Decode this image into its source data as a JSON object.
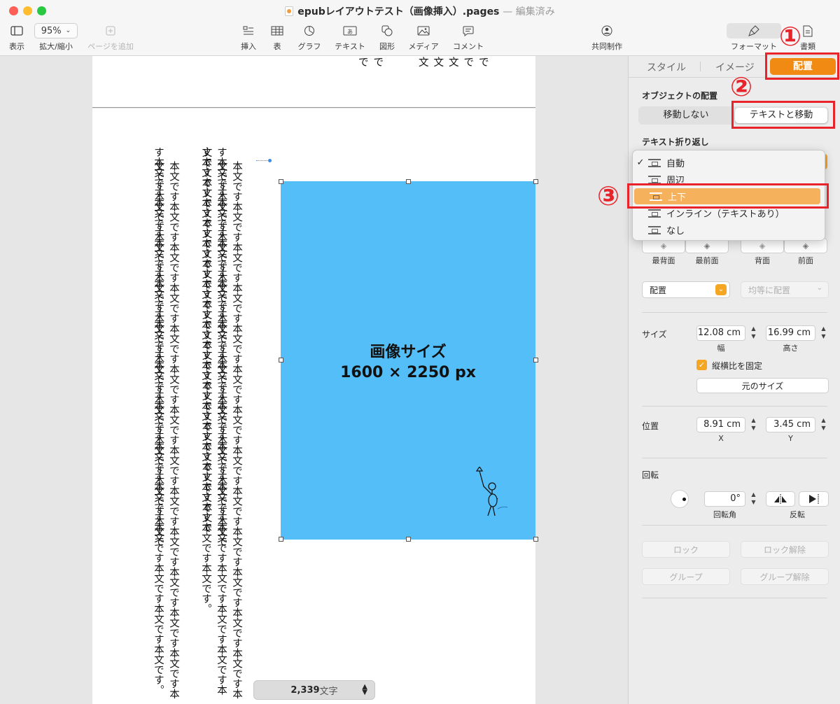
{
  "window": {
    "title": "epubレイアウトテスト（画像挿入）.pages",
    "title_sep": "—",
    "title_status": "編集済み"
  },
  "toolbar": {
    "view_label": "表示",
    "zoom_value": "95%",
    "zoom_label": "拡大/縮小",
    "add_page_label": "ページを追加",
    "insert_label": "挿入",
    "table_label": "表",
    "chart_label": "グラフ",
    "text_label": "テキスト",
    "shape_label": "図形",
    "media_label": "メディア",
    "comment_label": "コメント",
    "collab_label": "共同制作",
    "format_label": "フォーマット",
    "document_label": "書類"
  },
  "page": {
    "top_fragment_right": "文文文でで",
    "top_fragment_left": "でで",
    "columns": [
      "本文です本文です本文です本文です本文です本文です本文です本文です本文です本文です本文です本文です本文です本文です本文です本文です本文です本文です本文です本文です本文です本文です本文で",
      "す本文です本文です本文です本文です本文です本文です本文です本文です本文です本文です本文です本文です本文です本文です本文です本文です本文です本文です本文です本文です本文です本文です本文で",
      "す本文です本文です本文です本文です本文です本文です本文です本文です本文です本文です本文です。",
      "本文です本文です本文です本文です本文です本文です本文です本文です本文です本文です本文です本文です本文です本文です本文です本文です本文です本文です本文です本文です本文です本文です本文で",
      "す本文です本文です本文です本文です本文です本文です本文です本文です本文です本文です本文です本文です本文です。"
    ],
    "image_title": "画像サイズ",
    "image_size": "1600 × 2250 px",
    "image_color": "#53bef8"
  },
  "status": {
    "word_count": "2,339",
    "word_unit": "文字"
  },
  "sidebar": {
    "tabs": [
      "スタイル",
      "イメージ",
      "配置"
    ],
    "active_tab": "配置",
    "object_placement_label": "オブジェクトの配置",
    "placement_options": [
      "移動しない",
      "テキストと移動"
    ],
    "text_wrap_label": "テキスト折り返し",
    "arrange_labels": [
      "最背面",
      "最前面",
      "背面",
      "前面"
    ],
    "align_select": "配置",
    "distribute_select": "均等に配置",
    "size_label": "サイズ",
    "width_value": "12.08 cm",
    "width_caption": "幅",
    "height_value": "16.99 cm",
    "height_caption": "高さ",
    "constrain_label": "縦横比を固定",
    "constrain_checked": true,
    "original_size_button": "元のサイズ",
    "position_label": "位置",
    "x_value": "8.91 cm",
    "x_caption": "X",
    "y_value": "3.45 cm",
    "y_caption": "Y",
    "rotation_label": "回転",
    "angle_value": "0°",
    "angle_caption": "回転角",
    "flip_caption": "反転",
    "lock_button": "ロック",
    "unlock_button": "ロック解除",
    "group_button": "グループ",
    "ungroup_button": "グループ解除"
  },
  "wrap_menu": {
    "items": [
      "自動",
      "周辺",
      "上下",
      "インライン（テキストあり）",
      "なし"
    ],
    "checked": "自動",
    "highlighted": "上下"
  },
  "annotations": {
    "marker_1": "①",
    "marker_2": "②",
    "marker_3": "③",
    "color": "#e8242a"
  },
  "colors": {
    "accent_orange": "#f5a623",
    "active_tab": "#f08a12",
    "menu_highlight": "#f6b15d"
  }
}
